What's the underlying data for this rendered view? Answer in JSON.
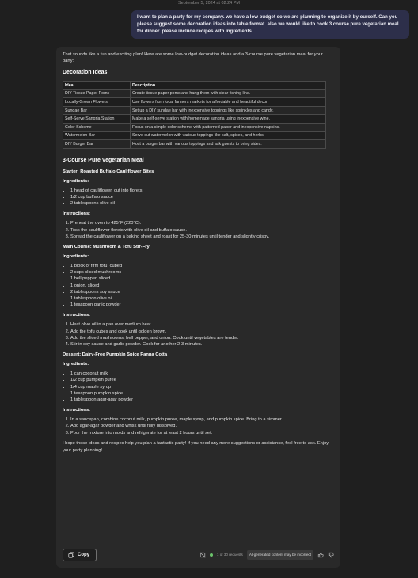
{
  "timestamp": "September 5, 2024 at 02:24 PM",
  "user_message": "I want to plan a party for my company. we have a low budget so we are planning to organize it by ourself. Can you please suggest some decoration ideas into table format. also we would like to cook 3 course pure vegetarian meal for dinner. please include recipes with ingredients.",
  "response": {
    "intro": "That sounds like a fun and exciting plan! Here are some low-budget decoration ideas and a 3-course pure vegetarian meal for your party:",
    "decor_heading": "Decoration Ideas",
    "table": {
      "headers": [
        "Idea",
        "Description"
      ],
      "rows": [
        [
          "DIY Tissue Paper Poms",
          "Create tissue paper poms and hang them with clear fishing line."
        ],
        [
          "Locally-Grown Flowers",
          "Use flowers from local farmers markets for affordable and beautiful decor."
        ],
        [
          "Sundae Bar",
          "Set up a DIY sundae bar with inexpensive toppings like sprinkles and candy."
        ],
        [
          "Self-Serve Sangria Station",
          "Make a self-serve station with homemade sangria using inexpensive wine."
        ],
        [
          "Color Scheme",
          "Focus on a simple color scheme with patterned paper and inexpensive napkins."
        ],
        [
          "Watermelon Bar",
          "Serve cut watermelon with various toppings like salt, spices, and herbs."
        ],
        [
          "DIY Burger Bar",
          "Host a burger bar with various toppings and ask guests to bring sides."
        ]
      ]
    },
    "meal_heading": "3-Course Pure Vegetarian Meal",
    "ingredients_label": "Ingredients:",
    "instructions_label": "Instructions:",
    "courses": [
      {
        "title": "Starter: Roasted Buffalo Cauliflower Bites",
        "ingredients": [
          "1 head of cauliflower, cut into florets",
          "1/2 cup buffalo sauce",
          "2 tablespoons olive oil"
        ],
        "instructions": [
          "Preheat the oven to 425°F (220°C).",
          "Toss the cauliflower florets with olive oil and buffalo sauce.",
          "Spread the cauliflower on a baking sheet and roast for 25-30 minutes until tender and slightly crispy."
        ]
      },
      {
        "title": "Main Course: Mushroom & Tofu Stir-Fry",
        "ingredients": [
          "1 block of firm tofu, cubed",
          "2 cups sliced mushrooms",
          "1 bell pepper, sliced",
          "1 onion, sliced",
          "2 tablespoons soy sauce",
          "1 tablespoon olive oil",
          "1 teaspoon garlic powder"
        ],
        "instructions": [
          "Heat olive oil in a pan over medium heat.",
          "Add the tofu cubes and cook until golden brown.",
          "Add the sliced mushrooms, bell pepper, and onion. Cook until vegetables are tender.",
          "Stir in soy sauce and garlic powder. Cook for another 2-3 minutes."
        ]
      },
      {
        "title": "Dessert: Dairy-Free Pumpkin Spice Panna Cotta",
        "ingredients": [
          "1 can coconut milk",
          "1/2 cup pumpkin puree",
          "1/4 cup maple syrup",
          "1 teaspoon pumpkin spice",
          "1 tablespoon agar-agar powder"
        ],
        "instructions": [
          "In a saucepan, combine coconut milk, pumpkin puree, maple syrup, and pumpkin spice. Bring to a simmer.",
          "Add agar-agar powder and whisk until fully dissolved.",
          "Pour the mixture into molds and refrigerate for at least 2 hours until set."
        ]
      }
    ],
    "closing": "I hope these ideas and recipes help you plan a fantastic party! If you need any more suggestions or assistance, feel free to ask. Enjoy your party planning!"
  },
  "footer": {
    "copy_label": "Copy",
    "requests": "1 of 30 requests",
    "ai_notice": "AI-generated content may be incorrect"
  },
  "icons": {
    "copy": "copy-icon",
    "no_context": "no-context-icon",
    "status": "status-dot-icon",
    "thumbs_up": "thumbs-up-icon",
    "thumbs_down": "thumbs-down-icon"
  },
  "colors": {
    "background": "#1f1f1f",
    "user_bubble": "#2d2f4a",
    "response_card": "#292929",
    "status_dot": "#6bc26b"
  }
}
